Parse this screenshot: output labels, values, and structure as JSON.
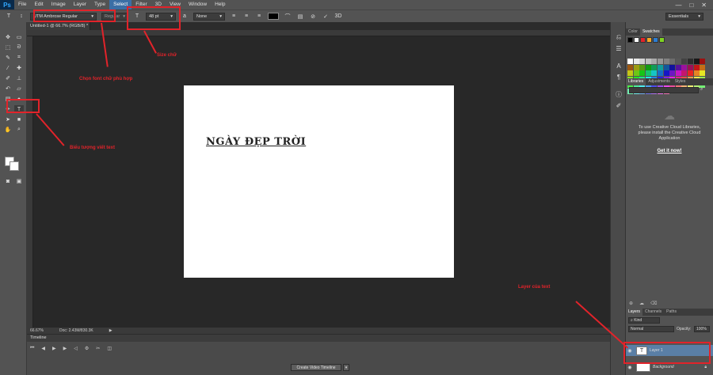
{
  "app": {
    "logo": "Ps"
  },
  "menu": [
    "File",
    "Edit",
    "Image",
    "Layer",
    "Type",
    "Select",
    "Filter",
    "3D",
    "View",
    "Window",
    "Help"
  ],
  "window_controls": [
    "—",
    "□",
    "✕"
  ],
  "options": {
    "font_family": "UTM Ambrose Regular",
    "font_style": "Regular",
    "font_size": "48 pt",
    "antialias": "None",
    "workspace": "Essentials"
  },
  "document": {
    "tab_title": "Untitled-1 @ 66.7% (RGB/8) *",
    "canvas_text": "NGÀY ĐẸP TRỜI",
    "zoom": "66.67%",
    "doc_info": "Doc: 2.43M/830.3K"
  },
  "timeline": {
    "title": "Timeline",
    "create_button": "Create Video Timeline"
  },
  "panels": {
    "color_tabs": [
      "Color",
      "Swatches"
    ],
    "library_tabs": [
      "Libraries",
      "Adjustments",
      "Styles"
    ],
    "library_message": "To use Creative Cloud Libraries, please install the Creative Cloud Application",
    "library_link": "Get it now!",
    "layers_tabs": [
      "Layers",
      "Channels",
      "Paths"
    ],
    "kind_label": "Kind",
    "blend_mode": "Normal",
    "opacity_label": "Opacity:",
    "opacity_value": "100%",
    "layers": [
      {
        "name": "Layer 1"
      },
      {
        "name": "Background"
      }
    ]
  },
  "annotations": {
    "font": "Chọn font chữ phù hợp",
    "size": "Size chữ",
    "text_tool": "Biểu tượng viết text",
    "layer": "Layer của text"
  },
  "colors": {
    "annotation_red": "#e2232a",
    "selected_menu": "#3b6ea5",
    "selected_layer": "#5a7fa6"
  }
}
